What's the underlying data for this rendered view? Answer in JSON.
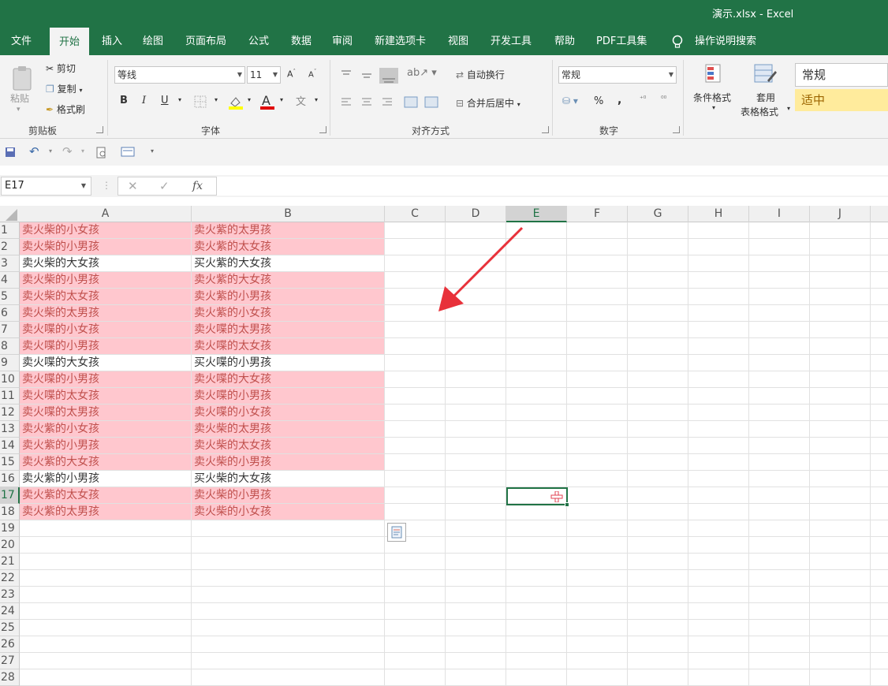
{
  "window": {
    "title": "演示.xlsx  -  Excel"
  },
  "tabs": [
    "文件",
    "开始",
    "插入",
    "绘图",
    "页面布局",
    "公式",
    "数据",
    "审阅",
    "新建选项卡",
    "视图",
    "开发工具",
    "帮助",
    "PDF工具集",
    "操作说明搜索"
  ],
  "ribbon": {
    "clipboard": {
      "paste": "粘贴",
      "cut": "剪切",
      "copy": "复制",
      "painter": "格式刷",
      "label": "剪贴板"
    },
    "font": {
      "name": "等线",
      "size": "11",
      "bold": "B",
      "italic": "I",
      "underline": "U",
      "label": "字体"
    },
    "alignment": {
      "wrap": "自动换行",
      "merge": "合并后居中",
      "label": "对齐方式"
    },
    "number": {
      "format": "常规",
      "percent": "%",
      "comma": ",",
      "label": "数字"
    },
    "styles": {
      "conditional": "条件格式",
      "table1": "套用",
      "table2": "表格格式",
      "normal": "常规",
      "neutral": "适中"
    }
  },
  "formula_bar": {
    "name_box": "E17",
    "fx": "fx",
    "value": ""
  },
  "columns": [
    "A",
    "B",
    "C",
    "D",
    "E",
    "F",
    "G",
    "H",
    "I",
    "J"
  ],
  "selected_cell": "E17",
  "rows": [
    {
      "n": "1",
      "a": "卖火柴的小女孩",
      "b": "卖火紫的太男孩",
      "dup": true
    },
    {
      "n": "2",
      "a": "卖火柴的小男孩",
      "b": "卖火紫的太女孩",
      "dup": true
    },
    {
      "n": "3",
      "a": "卖火柴的大女孩",
      "b": "买火紫的大女孩",
      "dup": false
    },
    {
      "n": "4",
      "a": "卖火柴的小男孩",
      "b": "卖火紫的大女孩",
      "dup": true
    },
    {
      "n": "5",
      "a": "卖火柴的太女孩",
      "b": "卖火紫的小男孩",
      "dup": true
    },
    {
      "n": "6",
      "a": "卖火柴的太男孩",
      "b": "卖火紫的小女孩",
      "dup": true
    },
    {
      "n": "7",
      "a": "卖火喋的小女孩",
      "b": "卖火喋的太男孩",
      "dup": true
    },
    {
      "n": "8",
      "a": "卖火喋的小男孩",
      "b": "卖火喋的太女孩",
      "dup": true
    },
    {
      "n": "9",
      "a": "卖火喋的大女孩",
      "b": "买火喋的小男孩",
      "dup": false
    },
    {
      "n": "10",
      "a": "卖火喋的小男孩",
      "b": "卖火喋的大女孩",
      "dup": true
    },
    {
      "n": "11",
      "a": "卖火喋的太女孩",
      "b": "卖火喋的小男孩",
      "dup": true
    },
    {
      "n": "12",
      "a": "卖火喋的太男孩",
      "b": "卖火喋的小女孩",
      "dup": true
    },
    {
      "n": "13",
      "a": "卖火紫的小女孩",
      "b": "卖火柴的太男孩",
      "dup": true
    },
    {
      "n": "14",
      "a": "卖火紫的小男孩",
      "b": "卖火柴的太女孩",
      "dup": true
    },
    {
      "n": "15",
      "a": "卖火紫的大女孩",
      "b": "卖火柴的小男孩",
      "dup": true
    },
    {
      "n": "16",
      "a": "卖火紫的小男孩",
      "b": "买火柴的大女孩",
      "dup": false
    },
    {
      "n": "17",
      "a": "卖火紫的太女孩",
      "b": "卖火柴的小男孩",
      "dup": true
    },
    {
      "n": "18",
      "a": "卖火紫的太男孩",
      "b": "卖火柴的小女孩",
      "dup": true
    },
    {
      "n": "19",
      "a": "",
      "b": "",
      "dup": false
    },
    {
      "n": "20",
      "a": "",
      "b": "",
      "dup": false
    },
    {
      "n": "21",
      "a": "",
      "b": "",
      "dup": false
    },
    {
      "n": "22",
      "a": "",
      "b": "",
      "dup": false
    },
    {
      "n": "23",
      "a": "",
      "b": "",
      "dup": false
    },
    {
      "n": "24",
      "a": "",
      "b": "",
      "dup": false
    },
    {
      "n": "25",
      "a": "",
      "b": "",
      "dup": false
    },
    {
      "n": "26",
      "a": "",
      "b": "",
      "dup": false
    },
    {
      "n": "27",
      "a": "",
      "b": "",
      "dup": false
    },
    {
      "n": "28",
      "a": "",
      "b": "",
      "dup": false
    }
  ],
  "colors": {
    "accent": "#217346",
    "dup_fill": "#ffc7ce",
    "dup_text": "#c0504d",
    "arrow": "#e8313a",
    "neutral_fill": "#ffeb9c"
  }
}
